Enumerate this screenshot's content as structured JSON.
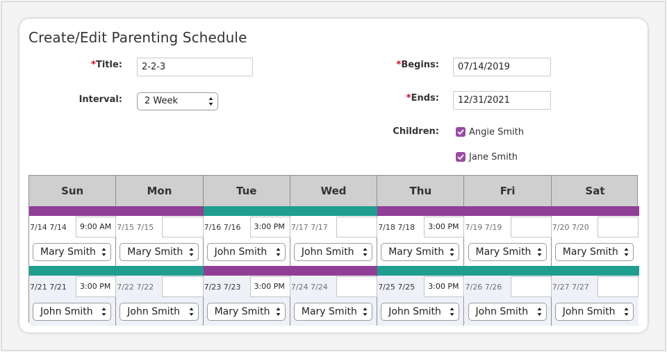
{
  "page": {
    "title": "Create/Edit Parenting Schedule"
  },
  "form": {
    "required_mark": "*",
    "title_label": "Title:",
    "title_value": "2-2-3",
    "interval_label": "Interval:",
    "interval_value": "2 Week",
    "begins_label": "Begins:",
    "begins_value": "07/14/2019",
    "ends_label": "Ends:",
    "ends_value": "12/31/2021",
    "children_label": "Children:",
    "children": [
      "Angie Smith",
      "Jane Smith"
    ]
  },
  "calendar": {
    "days": [
      "Sun",
      "Mon",
      "Tue",
      "Wed",
      "Thu",
      "Fri",
      "Sat"
    ],
    "weeks": [
      {
        "cells": [
          {
            "date": "7/14 7/14",
            "time": "9:00 AM",
            "parent": "Mary Smith",
            "color": "#913e95"
          },
          {
            "date": "7/15 7/15",
            "time": "",
            "parent": "Mary Smith",
            "color": "#913e95"
          },
          {
            "date": "7/16 7/16",
            "time": "3:00 PM",
            "parent": "John Smith",
            "color": "#1f9e8f"
          },
          {
            "date": "7/17 7/17",
            "time": "",
            "parent": "John Smith",
            "color": "#1f9e8f"
          },
          {
            "date": "7/18 7/18",
            "time": "3:00 PM",
            "parent": "Mary Smith",
            "color": "#913e95"
          },
          {
            "date": "7/19 7/19",
            "time": "",
            "parent": "Mary Smith",
            "color": "#913e95"
          },
          {
            "date": "7/20 7/20",
            "time": "",
            "parent": "Mary Smith",
            "color": "#913e95"
          }
        ]
      },
      {
        "cells": [
          {
            "date": "7/21 7/21",
            "time": "3:00 PM",
            "parent": "John Smith",
            "color": "#1f9e8f"
          },
          {
            "date": "7/22 7/22",
            "time": "",
            "parent": "John Smith",
            "color": "#1f9e8f"
          },
          {
            "date": "7/23 7/23",
            "time": "3:00 PM",
            "parent": "Mary Smith",
            "color": "#913e95"
          },
          {
            "date": "7/24 7/24",
            "time": "",
            "parent": "Mary Smith",
            "color": "#913e95"
          },
          {
            "date": "7/25 7/25",
            "time": "3:00 PM",
            "parent": "John Smith",
            "color": "#1f9e8f"
          },
          {
            "date": "7/26 7/26",
            "time": "",
            "parent": "John Smith",
            "color": "#1f9e8f"
          },
          {
            "date": "7/27 7/27",
            "time": "",
            "parent": "John Smith",
            "color": "#1f9e8f"
          }
        ]
      }
    ]
  }
}
